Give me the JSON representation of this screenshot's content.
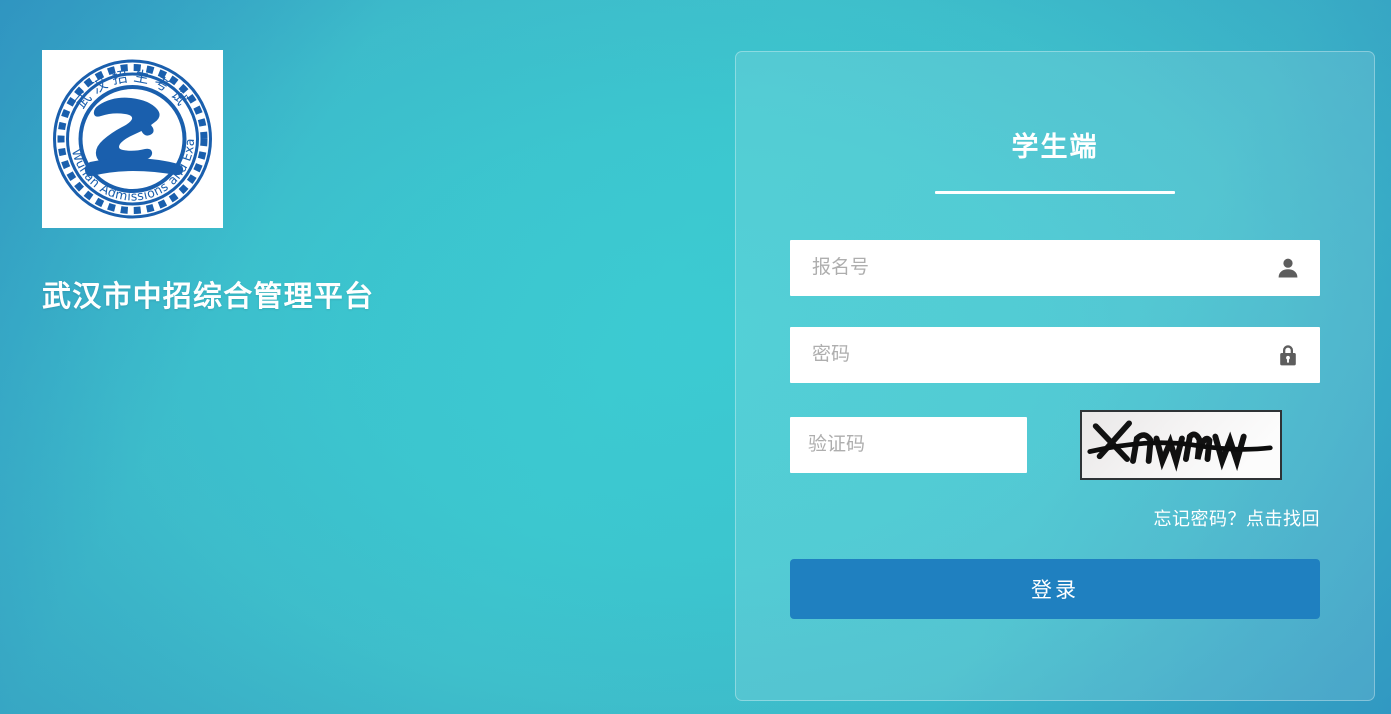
{
  "page": {
    "site_title": "武汉市中招综合管理平台",
    "background_color_center": "#3cc8d0",
    "background_color_corner": "#2f8fbe"
  },
  "logo": {
    "name": "wuhan-admissions-seal",
    "top_text": "武汉招生考试",
    "bottom_text": "Wuhan Admissions and Examinations",
    "center_glyph": "之",
    "color": "#1a5fad",
    "background": "#ffffff"
  },
  "panel": {
    "title": "学生端",
    "fields": [
      {
        "name": "registration-number",
        "placeholder": "报名号",
        "value": "",
        "type": "text",
        "icon": "user-icon"
      },
      {
        "name": "password",
        "placeholder": "密码",
        "value": "",
        "type": "password",
        "icon": "lock-icon"
      }
    ],
    "captcha": {
      "placeholder": "验证码",
      "value": "",
      "image_text": "Xnwmw",
      "image_alt": "captcha-image"
    },
    "forgot_password": "忘记密码？点击找回",
    "login_button": "登录",
    "login_button_color": "#1f80c0"
  }
}
